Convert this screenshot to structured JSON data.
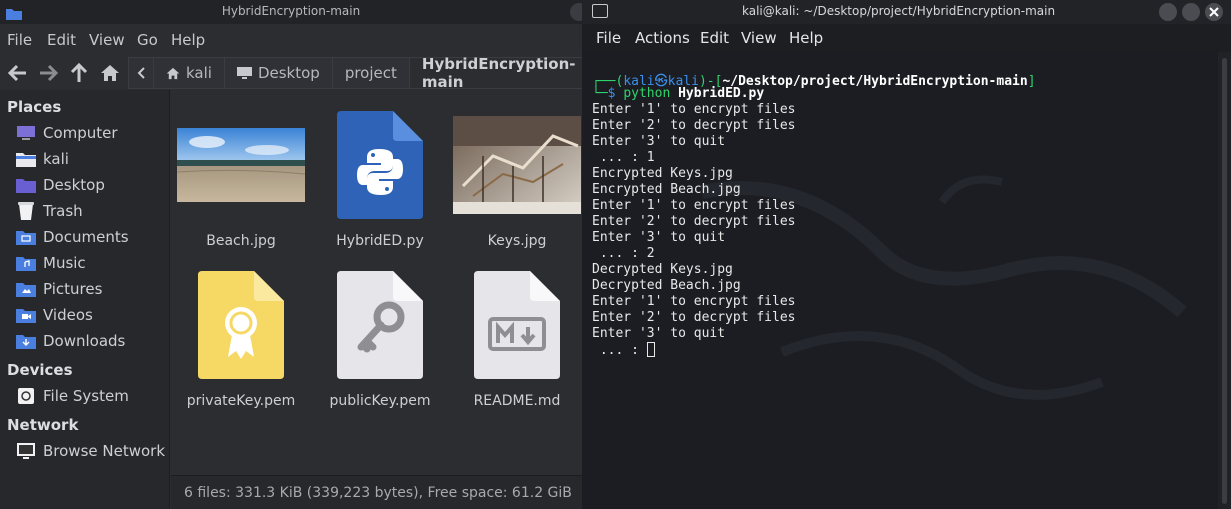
{
  "file_manager": {
    "title": "HybridEncryption-main",
    "menu": [
      "File",
      "Edit",
      "View",
      "Go",
      "Help"
    ],
    "breadcrumbs": [
      "kali",
      "Desktop",
      "project",
      "HybridEncryption-main"
    ],
    "sidebar": {
      "places_heading": "Places",
      "places": [
        {
          "label": "Computer",
          "icon": "computer-icon"
        },
        {
          "label": "kali",
          "icon": "home-folder-icon"
        },
        {
          "label": "Desktop",
          "icon": "desktop-folder-icon"
        },
        {
          "label": "Trash",
          "icon": "trash-icon"
        },
        {
          "label": "Documents",
          "icon": "documents-folder-icon"
        },
        {
          "label": "Music",
          "icon": "music-folder-icon"
        },
        {
          "label": "Pictures",
          "icon": "pictures-folder-icon"
        },
        {
          "label": "Videos",
          "icon": "videos-folder-icon"
        },
        {
          "label": "Downloads",
          "icon": "downloads-folder-icon"
        }
      ],
      "devices_heading": "Devices",
      "devices": [
        {
          "label": "File System",
          "icon": "drive-icon"
        }
      ],
      "network_heading": "Network",
      "network": [
        {
          "label": "Browse Network",
          "icon": "network-icon"
        }
      ]
    },
    "files": [
      {
        "name": "Beach.jpg",
        "icon": "beach-photo-thumbnail"
      },
      {
        "name": "HybridED.py",
        "icon": "python-file-icon"
      },
      {
        "name": "Keys.jpg",
        "icon": "keys-photo-thumbnail"
      },
      {
        "name": "privateKey.pem",
        "icon": "certificate-file-icon"
      },
      {
        "name": "publicKey.pem",
        "icon": "key-file-icon"
      },
      {
        "name": "README.md",
        "icon": "markdown-file-icon"
      }
    ],
    "status": "6 files: 331.3 KiB (339,223 bytes), Free space: 61.2 GiB"
  },
  "terminal": {
    "title": "kali@kali: ~/Desktop/project/HybridEncryption-main",
    "menu": [
      "File",
      "Actions",
      "Edit",
      "View",
      "Help"
    ],
    "prompt": {
      "open": "┌──(",
      "user": "kali",
      "at": "㉿",
      "host": "kali",
      "mid": ")-[",
      "path": "~/Desktop/project/HybridEncryption-main",
      "close": "]",
      "second": "└─",
      "dollar": "$ ",
      "cmd": "python ",
      "arg": "HybridED.py"
    },
    "lines": [
      "Enter '1' to encrypt files",
      "Enter '2' to decrypt files",
      "Enter '3' to quit",
      " ... : 1",
      "Encrypted Keys.jpg",
      "Encrypted Beach.jpg",
      "Enter '1' to encrypt files",
      "Enter '2' to decrypt files",
      "Enter '3' to quit",
      " ... : 2",
      "Decrypted Keys.jpg",
      "Decrypted Beach.jpg",
      "Enter '1' to encrypt files",
      "Enter '2' to decrypt files",
      "Enter '3' to quit",
      " ... : "
    ]
  },
  "colors": {
    "prompt_blue": "#3b8eea",
    "prompt_green": "#2fd36b",
    "folder_blue": "#4a7fe0",
    "python_blue": "#2f63b8"
  }
}
